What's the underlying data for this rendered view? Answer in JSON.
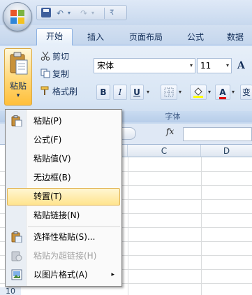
{
  "quick_access": {
    "undo": "↶",
    "redo": "↷",
    "dropdown": "▾",
    "customize": "₹"
  },
  "tabs": [
    {
      "label": "开始",
      "active": true
    },
    {
      "label": "插入",
      "active": false
    },
    {
      "label": "页面布局",
      "active": false
    },
    {
      "label": "公式",
      "active": false
    },
    {
      "label": "数据",
      "active": false
    }
  ],
  "clipboard": {
    "paste_label": "粘贴",
    "paste_arrow": "▾",
    "cut": "剪切",
    "copy": "复制",
    "format_painter": "格式刷"
  },
  "font": {
    "name": "宋体",
    "size": "11",
    "grow": "A",
    "bold": "B",
    "italic": "I",
    "underline": "U",
    "dropdown": "▾",
    "group_label": "字体",
    "phonetic": "变"
  },
  "formula_bar": {
    "fx": "fx"
  },
  "columns": [
    "C",
    "D"
  ],
  "rows": [
    "10"
  ],
  "paste_menu": {
    "items": [
      {
        "label": "粘贴(P)",
        "icon": "paste-icon",
        "state": "normal"
      },
      {
        "label": "公式(F)",
        "icon": "",
        "state": "normal"
      },
      {
        "label": "粘贴值(V)",
        "icon": "",
        "state": "normal"
      },
      {
        "label": "无边框(B)",
        "icon": "",
        "state": "normal"
      },
      {
        "label": "转置(T)",
        "icon": "",
        "state": "highlighted"
      },
      {
        "label": "粘贴链接(N)",
        "icon": "",
        "state": "normal"
      },
      {
        "label": "选择性粘贴(S)...",
        "icon": "paste-special-icon",
        "state": "normal"
      },
      {
        "label": "粘贴为超链接(H)",
        "icon": "paste-hyperlink-icon",
        "state": "disabled"
      },
      {
        "label": "以图片格式(A)",
        "icon": "picture-icon",
        "state": "normal",
        "submenu": "▸"
      }
    ]
  },
  "colors": {
    "accent": "#15305a",
    "highlight": "#ffe48e",
    "ribbon": "#d8e5f4"
  }
}
